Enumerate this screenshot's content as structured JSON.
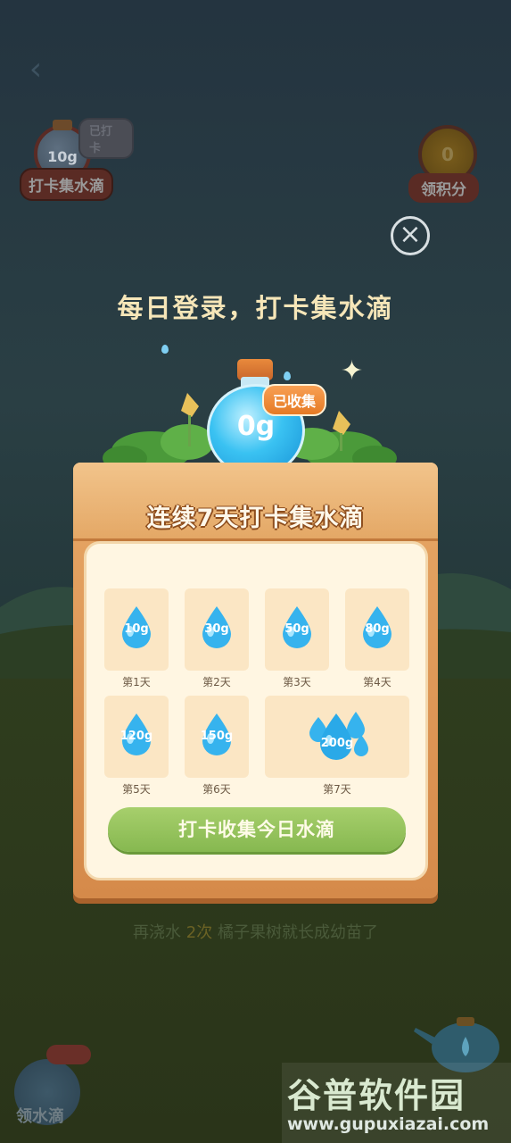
{
  "background": {
    "checkin_widget": {
      "amount": "10g",
      "tag": "已打卡",
      "label": "打卡集水滴"
    },
    "points_widget": {
      "value": "0",
      "label": "领积分"
    },
    "progress": {
      "prefix": "再浇水 ",
      "count": "2次",
      "suffix": " 橘子果树就长成幼苗了"
    },
    "water_widget": {
      "label": "领水滴"
    }
  },
  "modal": {
    "title": "每日登录，打卡集水滴",
    "close_icon": "close-icon",
    "bottle": {
      "amount": "0g",
      "badge": "已收集"
    },
    "board_title": "连续7天打卡集水滴",
    "days": [
      {
        "amount": "10g",
        "label": "第1天"
      },
      {
        "amount": "30g",
        "label": "第2天"
      },
      {
        "amount": "50g",
        "label": "第3天"
      },
      {
        "amount": "80g",
        "label": "第4天"
      },
      {
        "amount": "120g",
        "label": "第5天"
      },
      {
        "amount": "150g",
        "label": "第6天"
      },
      {
        "amount": "200g",
        "label": "第7天"
      }
    ],
    "button_label": "打卡收集今日水滴"
  },
  "watermark": {
    "title": "谷普软件园",
    "url": "www.gupuxiazai.com"
  },
  "colors": {
    "accent_green": "#94c25e",
    "wood": "#e2a05e",
    "water": "#3ab8ef",
    "badge_orange": "#ef8b3a"
  }
}
